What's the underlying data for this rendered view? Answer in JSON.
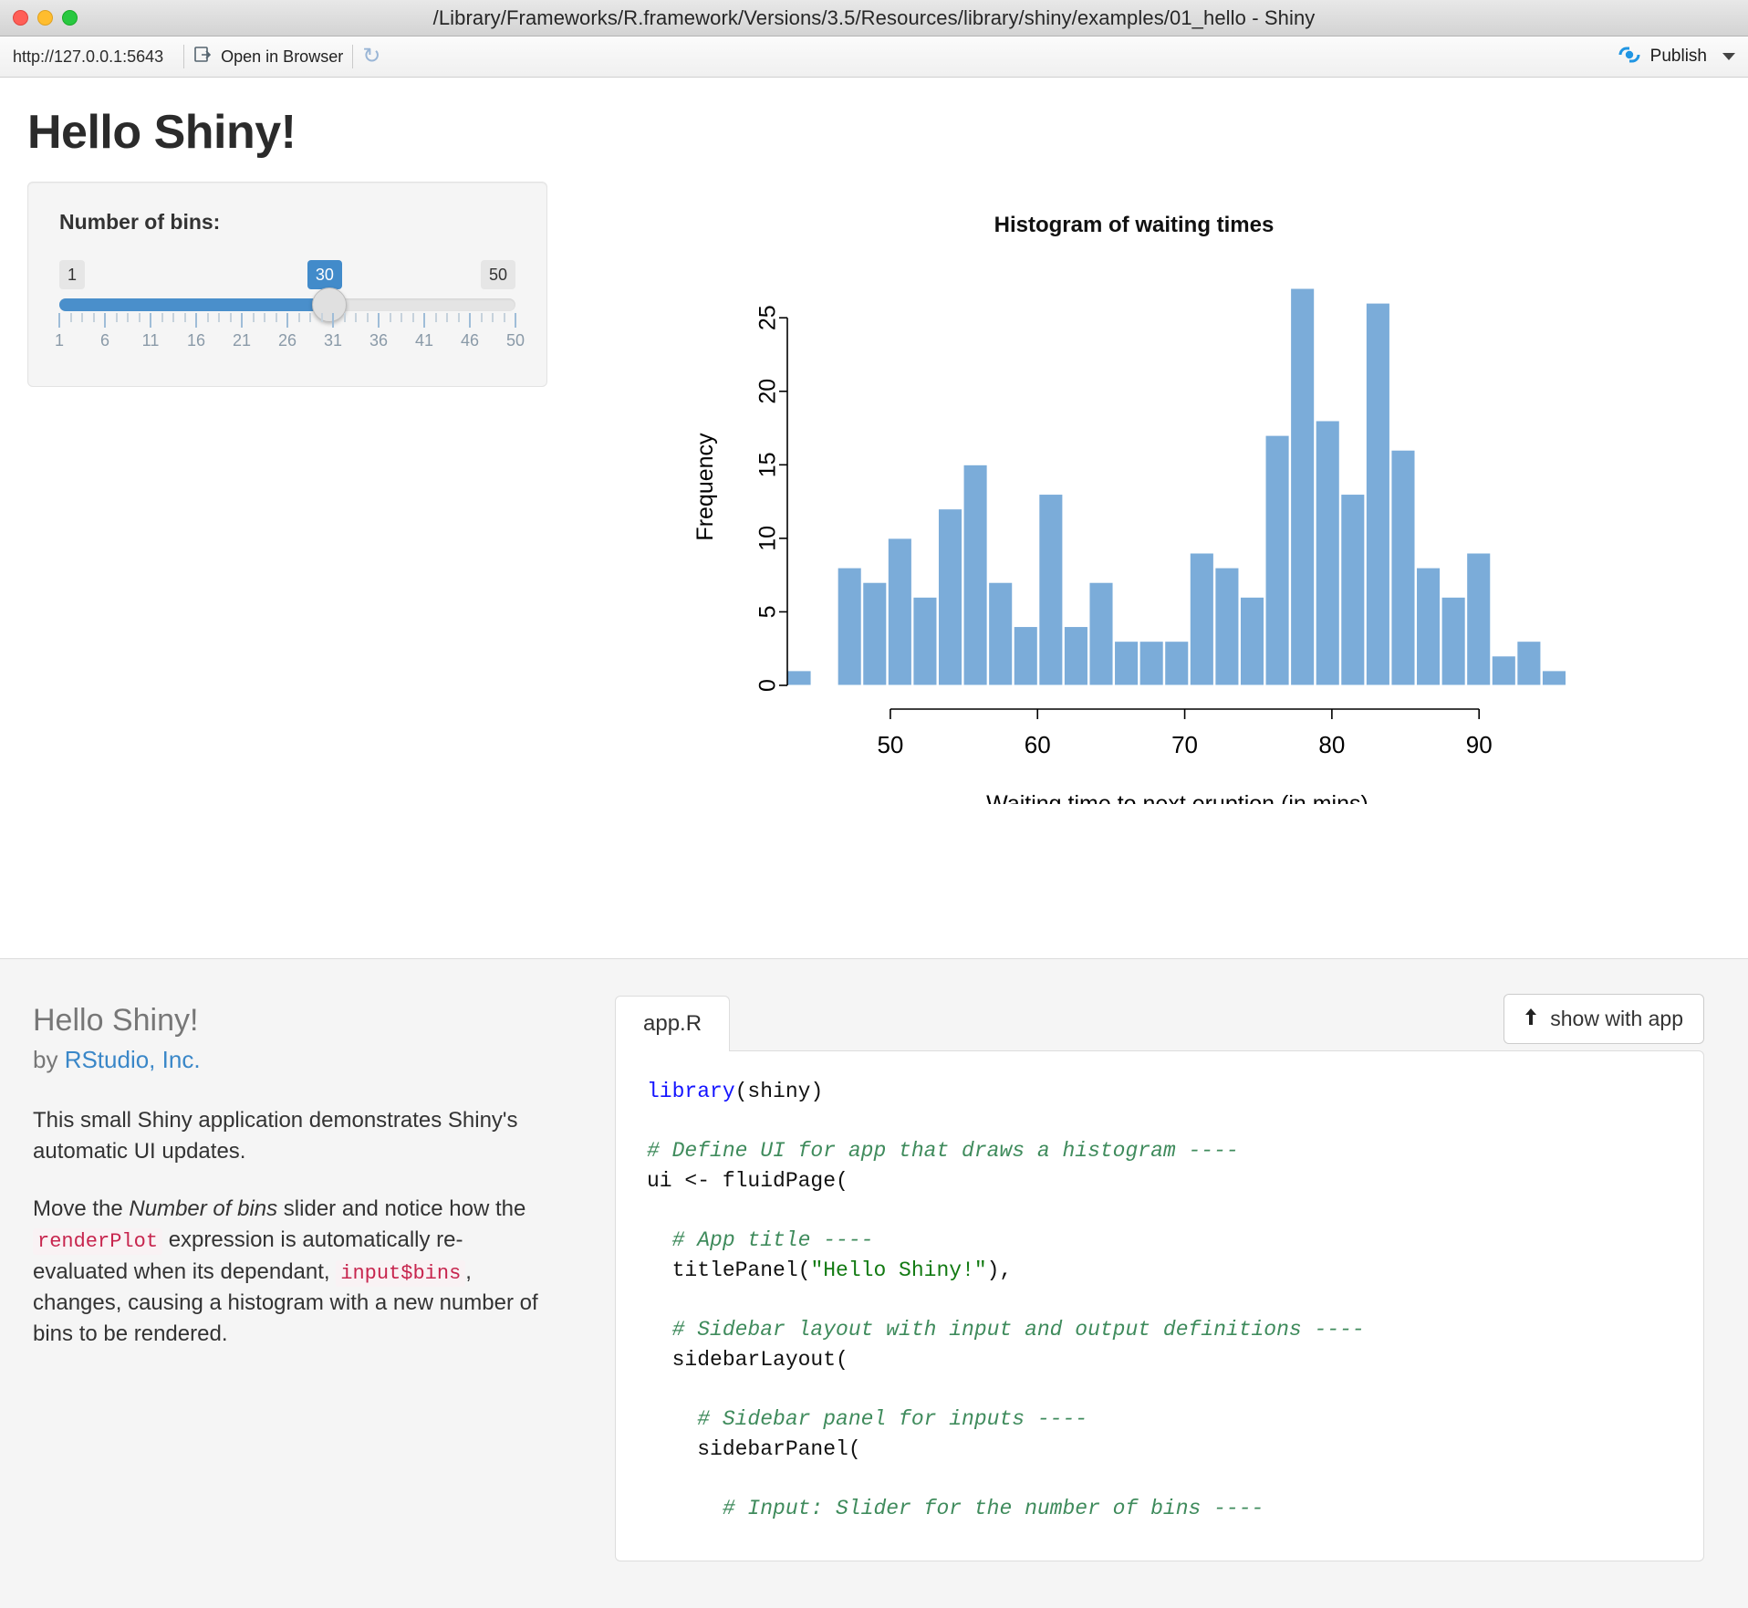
{
  "window": {
    "title": "/Library/Frameworks/R.framework/Versions/3.5/Resources/library/shiny/examples/01_hello - Shiny",
    "close_icon": "close-dot",
    "minimize_icon": "minimize-dot",
    "maximize_icon": "maximize-dot"
  },
  "toolbar": {
    "url": "http://127.0.0.1:5643",
    "open_in_browser_label": "Open in Browser",
    "open_in_browser_icon": "browser-icon",
    "refresh_icon": "refresh-icon",
    "publish_label": "Publish",
    "publish_icon": "publish-icon",
    "publish_caret_icon": "chevron-down-icon"
  },
  "app": {
    "title": "Hello Shiny!"
  },
  "slider": {
    "label": "Number of bins:",
    "min": "1",
    "max": "50",
    "value": "30",
    "tick_labels": [
      "1",
      "6",
      "11",
      "16",
      "21",
      "26",
      "31",
      "36",
      "41",
      "46",
      "50"
    ],
    "accent_color": "#428bca",
    "fill_color": "#4a8fcb"
  },
  "chart_data": {
    "type": "bar",
    "title": "Histogram of waiting times",
    "xlabel": "Waiting time to next eruption (in mins)",
    "ylabel": "Frequency",
    "bar_color": "#7bacd9",
    "grid": false,
    "legend": null,
    "xlim": [
      43,
      96
    ],
    "ylim": [
      0,
      27
    ],
    "xticks": [
      50,
      60,
      70,
      80,
      90
    ],
    "yticks": [
      0,
      5,
      10,
      15,
      20,
      25
    ],
    "bin_width": 1.7667,
    "bin_starts": [
      43.0,
      44.77,
      46.53,
      48.3,
      50.07,
      51.83,
      53.6,
      55.37,
      57.13,
      58.9,
      60.67,
      62.43,
      64.2,
      65.97,
      67.73,
      69.5,
      71.27,
      73.03,
      74.8,
      76.57,
      78.33,
      80.1,
      81.87,
      83.63,
      85.4,
      87.17,
      88.93,
      90.7,
      92.47,
      94.23
    ],
    "values": [
      1,
      0,
      8,
      7,
      10,
      6,
      12,
      15,
      7,
      4,
      13,
      4,
      7,
      3,
      3,
      3,
      9,
      8,
      6,
      17,
      27,
      18,
      13,
      26,
      16,
      8,
      6,
      9,
      2,
      3,
      1
    ],
    "categories": [
      "43.0",
      "44.8",
      "46.5",
      "48.3",
      "50.1",
      "51.8",
      "53.6",
      "55.4",
      "57.1",
      "58.9",
      "60.7",
      "62.4",
      "64.2",
      "66.0",
      "67.7",
      "69.5",
      "71.3",
      "73.0",
      "74.8",
      "76.6",
      "78.3",
      "80.1",
      "81.9",
      "83.6",
      "85.4",
      "87.2",
      "88.9",
      "90.7",
      "92.5",
      "94.2",
      "95.9"
    ]
  },
  "showcase": {
    "doc_title": "Hello Shiny!",
    "by_prefix": "by ",
    "author": "RStudio, Inc.",
    "paragraph1": "This small Shiny application demonstrates Shiny's automatic UI updates.",
    "p2_a": "Move the ",
    "p2_em": "Number of bins",
    "p2_b": " slider and notice how the ",
    "p2_code1": "renderPlot",
    "p2_c": " expression is automatically re-evaluated when its dependant, ",
    "p2_code2": "input$bins",
    "p2_d": ", changes, causing a histogram with a new number of bins to be rendered.",
    "tab_label": "app.R",
    "show_with_app_label": "show with app",
    "show_with_app_icon": "up-arrow-icon",
    "code_lines": [
      "library(shiny)",
      "",
      "# Define UI for app that draws a histogram ----",
      "ui <- fluidPage(",
      "",
      "  # App title ----",
      "  titlePanel(\"Hello Shiny!\"),",
      "",
      "  # Sidebar layout with input and output definitions ----",
      "  sidebarLayout(",
      "",
      "    # Sidebar panel for inputs ----",
      "    sidebarPanel(",
      "",
      "      # Input: Slider for the number of bins ----"
    ]
  }
}
